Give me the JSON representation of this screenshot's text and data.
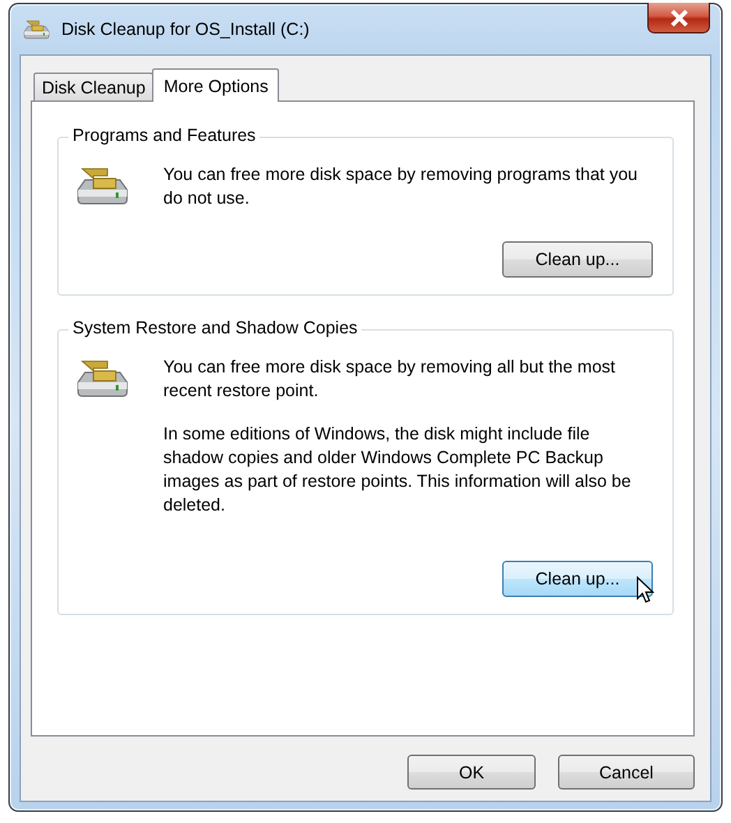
{
  "window": {
    "title": "Disk Cleanup for OS_Install (C:)"
  },
  "tabs": [
    {
      "label": "Disk Cleanup",
      "selected": false
    },
    {
      "label": "More Options",
      "selected": true
    }
  ],
  "groups": [
    {
      "title": "Programs and Features",
      "paragraphs": [
        "You can free more disk space by removing programs that you do not use."
      ],
      "button": {
        "label": "Clean up...",
        "hovered": false
      }
    },
    {
      "title": "System Restore and Shadow Copies",
      "paragraphs": [
        "You can free more disk space by removing all but the most recent restore point.",
        "In some editions of Windows, the disk might include file shadow copies and older Windows Complete PC Backup images as part of restore points. This information will also be deleted."
      ],
      "button": {
        "label": "Clean up...",
        "hovered": true
      }
    }
  ],
  "buttons": [
    {
      "label": "OK"
    },
    {
      "label": "Cancel"
    }
  ]
}
